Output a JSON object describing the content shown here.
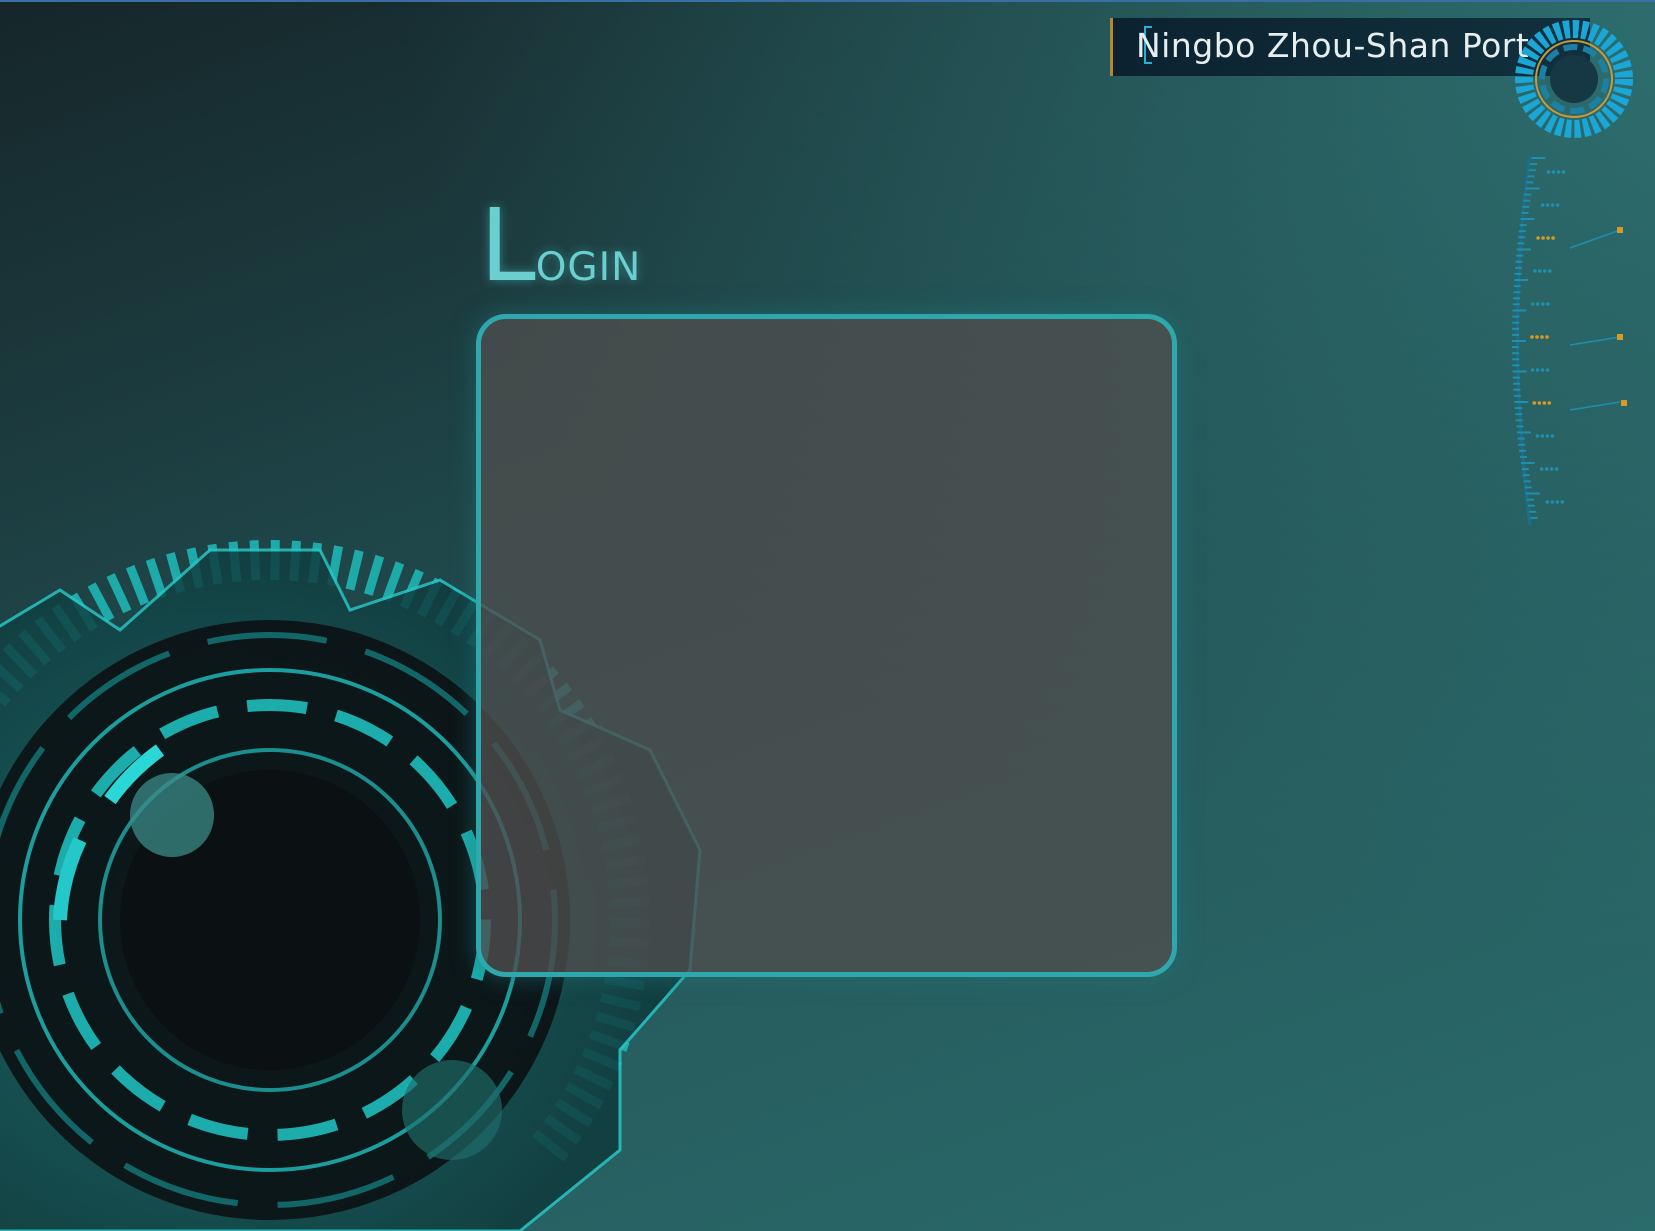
{
  "header": {
    "title": "Ningbo Zhou-Shan Port"
  },
  "login": {
    "heading_initial": "L",
    "heading_rest": "OGIN"
  },
  "icons": {
    "ring": "ring-gauge-icon",
    "gear": "gear-decoration",
    "ruler": "ruler-scale-decoration"
  },
  "colors": {
    "accent": "#2fa8ad",
    "title_border": "#b38a2a",
    "ring": "#1aa6d6",
    "ruler_highlight": "#d89a22"
  }
}
